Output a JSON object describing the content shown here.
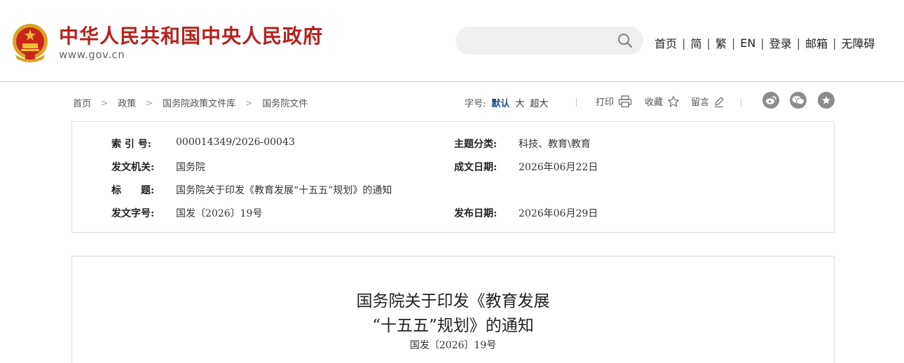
{
  "header": {
    "site_title": "中华人民共和国中央人民政府",
    "site_domain": "www.gov.cn",
    "brand_color": "#b5221d",
    "search": {
      "placeholder": "",
      "value": ""
    },
    "nav": [
      {
        "label": "首页"
      },
      {
        "label": "简"
      },
      {
        "label": "繁"
      },
      {
        "label": "EN"
      },
      {
        "label": "登录"
      },
      {
        "label": "邮箱"
      },
      {
        "label": "无障碍"
      }
    ]
  },
  "toolbar": {
    "breadcrumb": [
      "首页",
      "政策",
      "国务院政策文件库",
      "国务院文件"
    ],
    "font_size_label": "字号:",
    "font_sizes": [
      "默认",
      "大",
      "超大"
    ],
    "selected_font_size": "默认",
    "print_label": "打印",
    "favorite_label": "收藏",
    "comment_label": "留言",
    "share_icons": [
      "weibo-icon",
      "wechat-icon",
      "star-share-icon"
    ]
  },
  "meta": {
    "index_no": {
      "label": "索 引 号:",
      "value": "000014349/2026-00043"
    },
    "topic": {
      "label": "主题分类:",
      "value": "科技、教育\\教育"
    },
    "issuer": {
      "label": "发文机关:",
      "value": "国务院"
    },
    "created_date": {
      "label": "成文日期:",
      "value": "2026年06月22日"
    },
    "title": {
      "label": "标　　题:",
      "value": "国务院关于印发《教育发展“十五五”规划》的通知"
    },
    "doc_no": {
      "label": "发文字号:",
      "value": "国发〔2026〕19号"
    },
    "published_date": {
      "label": "发布日期:",
      "value": "2026年06月29日"
    }
  },
  "document": {
    "title_line1": "国务院关于印发《教育发展",
    "title_line2": "“十五五”规划》的通知",
    "doc_number": "国发〔2026〕19号"
  }
}
